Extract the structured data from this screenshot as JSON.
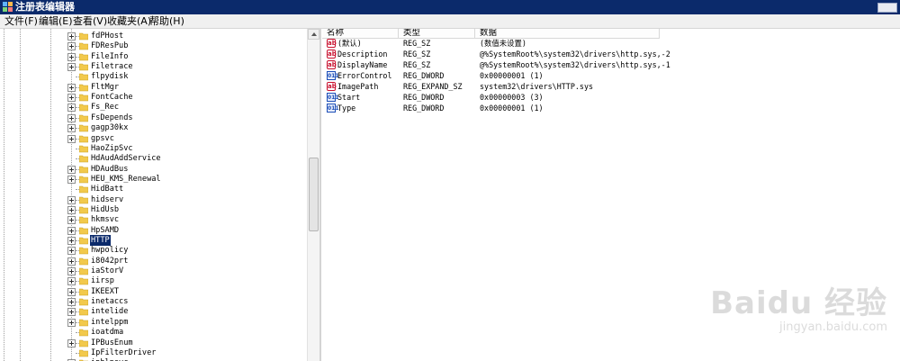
{
  "window": {
    "title": "注册表编辑器"
  },
  "menu": [
    "文件(F)",
    "编辑(E)",
    "查看(V)",
    "收藏夹(A)",
    "帮助(H)"
  ],
  "tree": {
    "selected": "HTTP",
    "items": [
      {
        "label": "fdPHost",
        "expandable": true
      },
      {
        "label": "FDResPub",
        "expandable": true
      },
      {
        "label": "FileInfo",
        "expandable": true
      },
      {
        "label": "Filetrace",
        "expandable": true
      },
      {
        "label": "flpydisk",
        "expandable": false
      },
      {
        "label": "FltMgr",
        "expandable": true
      },
      {
        "label": "FontCache",
        "expandable": true
      },
      {
        "label": "Fs_Rec",
        "expandable": true
      },
      {
        "label": "FsDepends",
        "expandable": true
      },
      {
        "label": "gagp30kx",
        "expandable": true
      },
      {
        "label": "gpsvc",
        "expandable": true
      },
      {
        "label": "HaoZipSvc",
        "expandable": false
      },
      {
        "label": "HdAudAddService",
        "expandable": false
      },
      {
        "label": "HDAudBus",
        "expandable": true
      },
      {
        "label": "HEU_KMS_Renewal",
        "expandable": true
      },
      {
        "label": "HidBatt",
        "expandable": false
      },
      {
        "label": "hidserv",
        "expandable": true
      },
      {
        "label": "HidUsb",
        "expandable": true
      },
      {
        "label": "hkmsvc",
        "expandable": true
      },
      {
        "label": "HpSAMD",
        "expandable": true
      },
      {
        "label": "HTTP",
        "expandable": true
      },
      {
        "label": "hwpolicy",
        "expandable": true
      },
      {
        "label": "i8042prt",
        "expandable": true
      },
      {
        "label": "iaStorV",
        "expandable": true
      },
      {
        "label": "iirsp",
        "expandable": true
      },
      {
        "label": "IKEEXT",
        "expandable": true
      },
      {
        "label": "inetaccs",
        "expandable": true
      },
      {
        "label": "intelide",
        "expandable": true
      },
      {
        "label": "intelppm",
        "expandable": true
      },
      {
        "label": "ioatdma",
        "expandable": false
      },
      {
        "label": "IPBusEnum",
        "expandable": true
      },
      {
        "label": "IpFilterDriver",
        "expandable": false
      },
      {
        "label": "iphlpsvc",
        "expandable": true
      }
    ]
  },
  "columns": {
    "name": "名称",
    "type": "类型",
    "data": "数据"
  },
  "values": [
    {
      "icon": "string-value-icon",
      "kind": "ab",
      "name": "(默认)",
      "type": "REG_SZ",
      "data": "(数值未设置)"
    },
    {
      "icon": "string-value-icon",
      "kind": "ab",
      "name": "Description",
      "type": "REG_SZ",
      "data": "@%SystemRoot%\\system32\\drivers\\http.sys,-2"
    },
    {
      "icon": "string-value-icon",
      "kind": "ab",
      "name": "DisplayName",
      "type": "REG_SZ",
      "data": "@%SystemRoot%\\system32\\drivers\\http.sys,-1"
    },
    {
      "icon": "binary-value-icon",
      "kind": "bin",
      "name": "ErrorControl",
      "type": "REG_DWORD",
      "data": "0x00000001 (1)"
    },
    {
      "icon": "string-value-icon",
      "kind": "ab",
      "name": "ImagePath",
      "type": "REG_EXPAND_SZ",
      "data": "system32\\drivers\\HTTP.sys"
    },
    {
      "icon": "binary-value-icon",
      "kind": "bin",
      "name": "Start",
      "type": "REG_DWORD",
      "data": "0x00000003 (3)"
    },
    {
      "icon": "binary-value-icon",
      "kind": "bin",
      "name": "Type",
      "type": "REG_DWORD",
      "data": "0x00000001 (1)"
    }
  ],
  "watermark": {
    "logo": "Baidu 经验",
    "url": "jingyan.baidu.com"
  },
  "colors": {
    "titlebar": "#0b2a6b",
    "selection": "#0b2a6b",
    "folder": "#f2c94c"
  }
}
